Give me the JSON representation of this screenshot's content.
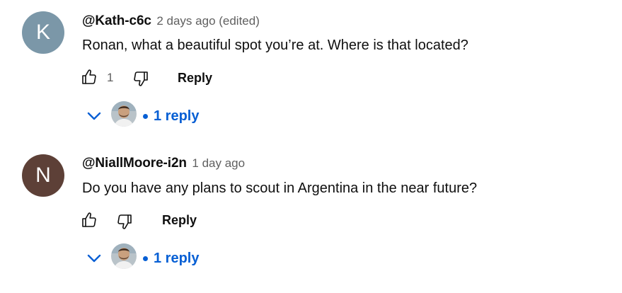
{
  "comments": [
    {
      "avatar_letter": "K",
      "avatar_color": "#7b97a8",
      "handle": "@Kath-c6c",
      "time": "2 days ago (edited)",
      "text": "Ronan, what a beautiful spot you’re at. Where is that located?",
      "like_count": "1",
      "reply_label": "Reply",
      "replies_label": "1 reply"
    },
    {
      "avatar_letter": "N",
      "avatar_color": "#5d4037",
      "handle": "@NiallMoore-i2n",
      "time": "1 day ago",
      "text": "Do you have any plans to scout in Argentina in the near future?",
      "like_count": "",
      "reply_label": "Reply",
      "replies_label": "1 reply"
    }
  ],
  "icons": {
    "like": "thumbs-up-icon",
    "dislike": "thumbs-down-icon",
    "expand": "chevron-down-icon",
    "reply_author": "avatar"
  },
  "colors": {
    "link_blue": "#065fd4",
    "secondary_text": "#606060",
    "primary_text": "#0f0f0f"
  }
}
